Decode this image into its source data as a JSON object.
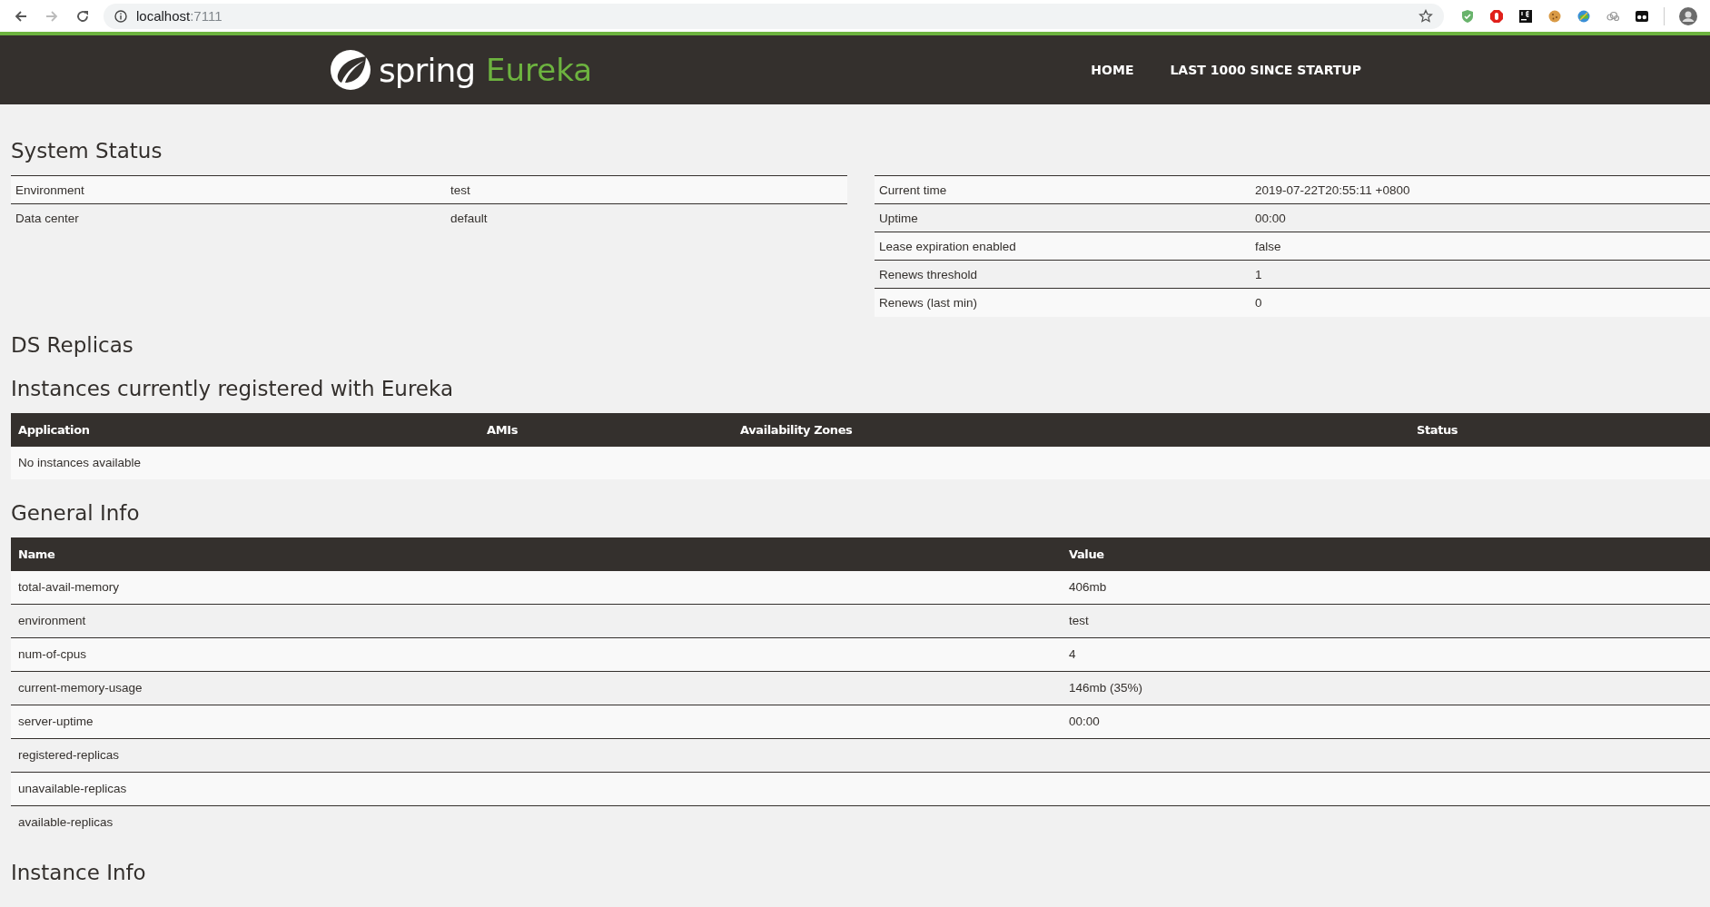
{
  "browser": {
    "nav_buttons": [
      {
        "kind": "back",
        "disabled": false
      },
      {
        "kind": "forward",
        "disabled": true
      },
      {
        "kind": "reload",
        "disabled": false
      }
    ],
    "url_host": "localhost",
    "url_port": ":7111"
  },
  "navbar": {
    "brand_word": "spring",
    "brand_product": "Eureka",
    "links": [
      "HOME",
      "LAST 1000 SINCE STARTUP"
    ]
  },
  "system_status": {
    "title": "System Status",
    "left": [
      {
        "label": "Environment",
        "value": "test"
      },
      {
        "label": "Data center",
        "value": "default"
      }
    ],
    "right": [
      {
        "label": "Current time",
        "value": "2019-07-22T20:55:11 +0800"
      },
      {
        "label": "Uptime",
        "value": "00:00"
      },
      {
        "label": "Lease expiration enabled",
        "value": "false"
      },
      {
        "label": "Renews threshold",
        "value": "1"
      },
      {
        "label": "Renews (last min)",
        "value": "0"
      }
    ]
  },
  "ds_replicas": {
    "title": "DS Replicas"
  },
  "instances": {
    "title": "Instances currently registered with Eureka",
    "columns": [
      "Application",
      "AMIs",
      "Availability Zones",
      "Status"
    ],
    "empty_message": "No instances available"
  },
  "general_info": {
    "title": "General Info",
    "columns": [
      "Name",
      "Value"
    ],
    "rows": [
      {
        "name": "total-avail-memory",
        "value": "406mb"
      },
      {
        "name": "environment",
        "value": "test"
      },
      {
        "name": "num-of-cpus",
        "value": "4"
      },
      {
        "name": "current-memory-usage",
        "value": "146mb (35%)"
      },
      {
        "name": "server-uptime",
        "value": "00:00"
      },
      {
        "name": "registered-replicas",
        "value": ""
      },
      {
        "name": "unavailable-replicas",
        "value": ""
      },
      {
        "name": "available-replicas",
        "value": ""
      }
    ]
  },
  "instance_info": {
    "title": "Instance Info"
  }
}
